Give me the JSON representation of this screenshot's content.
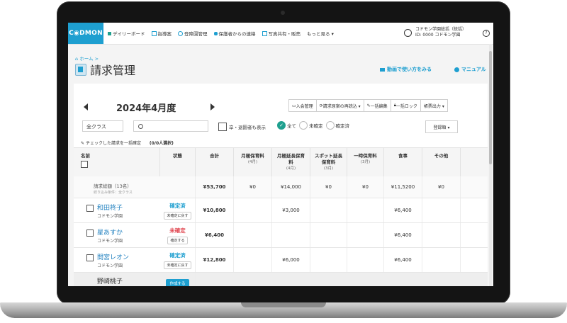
{
  "brand": {
    "logo_text": "C◉DMON",
    "accent": "#1e9fd0"
  },
  "nav": {
    "items": [
      {
        "label": "デイリーボード",
        "icon": "board-icon"
      },
      {
        "label": "指導案",
        "icon": "document-icon"
      },
      {
        "label": "登降園管理",
        "icon": "clock-icon"
      },
      {
        "label": "保護者からの連絡",
        "icon": "phone-icon"
      },
      {
        "label": "写真共有・販売",
        "icon": "photo-icon"
      },
      {
        "label": "もっと見る ▾",
        "icon": "more-icon"
      }
    ],
    "user_line1": "コドモン学園総括（統括）",
    "user_line2": "ID: 0000 コドモン学園",
    "help": "?"
  },
  "header": {
    "breadcrumb": "ホーム >",
    "title": "請求管理",
    "video_link": "動画で使い方をみる",
    "manual_link": "マニュアル"
  },
  "billing": {
    "month": "2024年4月度",
    "toolbar": [
      "入会管理",
      "請求原案の再読込 ▾",
      "一括編集",
      "一括ロック",
      "帳票出力 ▾"
    ],
    "class_filter": "全クラス",
    "search_placeholder": "",
    "include_graduates": "卒・退園者も表示",
    "status_filters": [
      {
        "label": "全て",
        "checked": true
      },
      {
        "label": "未確定",
        "checked": false
      },
      {
        "label": "確定済",
        "checked": false
      }
    ],
    "sort_label": "登録順 ▾",
    "bulk_confirm": "チェックした請求を一括確定",
    "selected_count": "(0/0人選択)"
  },
  "table": {
    "headers": [
      {
        "label": "名前",
        "sub": ""
      },
      {
        "label": "状態",
        "sub": ""
      },
      {
        "label": "合計",
        "sub": ""
      },
      {
        "label": "月極保育料",
        "sub": "(4月)"
      },
      {
        "label": "月極延長保育料",
        "sub": "(4月)"
      },
      {
        "label": "スポット延長保育料",
        "sub": "(3月)"
      },
      {
        "label": "一時保育料",
        "sub": "(3月)"
      },
      {
        "label": "食事",
        "sub": ""
      },
      {
        "label": "その他",
        "sub": ""
      }
    ],
    "summary": {
      "name": "請求総額（13名）",
      "sub": "絞り込み条件：全クラス",
      "values": [
        "¥53,700",
        "¥0",
        "¥14,000",
        "¥0",
        "¥0",
        "¥11,5200",
        "¥0"
      ]
    },
    "rows": [
      {
        "name": "和田柊子",
        "school": "コドモン学園",
        "status": "確定済",
        "status_kind": "ok",
        "action": "未確定に戻す",
        "values": [
          "¥10,800",
          "",
          "¥3,000",
          "",
          "",
          "¥6,400",
          ""
        ]
      },
      {
        "name": "星あすか",
        "school": "コドモン学園",
        "status": "未確定",
        "status_kind": "ng",
        "action": "確定する",
        "values": [
          "¥6,400",
          "",
          "",
          "",
          "",
          "¥6,400",
          ""
        ]
      },
      {
        "name": "間宮レオン",
        "school": "コドモン学園",
        "status": "確定済",
        "status_kind": "ok",
        "action": "未確定に戻す",
        "values": [
          "¥12,800",
          "",
          "¥6,000",
          "",
          "",
          "¥6,400",
          ""
        ]
      }
    ],
    "last_row": {
      "name": "野崎桃子",
      "action": "作成する"
    }
  }
}
